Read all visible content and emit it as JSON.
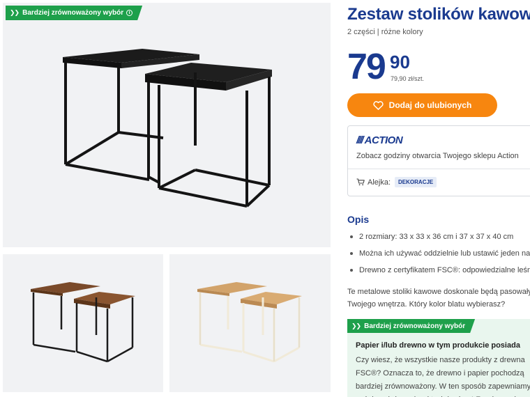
{
  "gallery": {
    "badge_label": "Bardziej zrównoważony wybór",
    "badge_info": "i"
  },
  "product": {
    "title": "Zestaw stolików kawowych",
    "subtitle": "2 części | różne kolory",
    "price_int": "79",
    "price_dec": "90",
    "price_unit": "79,90 zł/szt.",
    "favorite_label": "Dodaj do ulubionych"
  },
  "store": {
    "logo": "ACTION",
    "hours_link": "Zobacz godziny otwarcia Twojego sklepu Action",
    "aisle_label": "Alejka:",
    "aisle_value": "DEKORACJE"
  },
  "description": {
    "heading": "Opis",
    "bullets": [
      "2 rozmiary: 33 x 33 x 36 cm i 37 x 37 x 40 cm",
      "Można ich używać oddzielnie lub ustawić jeden na drugim",
      "Drewno z certyfikatem FSC®: odpowiedzialne leśnictwo"
    ],
    "paragraph": "Te metalowe stoliki kawowe doskonale będą pasowały do Twojego wnętrza. Który kolor blatu wybierasz?"
  },
  "sustainability": {
    "badge_label": "Bardziej zrównoważony wybór",
    "title": "Papier i/lub drewno w tym produkcie posiada",
    "text": "Czy wiesz, że wszystkie nasze produkty z drewna\nFSC®? Oznacza to, że drewno i papier pochodzą\nbardziej zrównoważony. W ten sposób zapewniamy\nsośnie założonych od tych lasów. * Z wyłączeniem"
  },
  "colors": {
    "brand_blue": "#1a3a8f",
    "accent_orange": "#f7860f",
    "sustain_green": "#1ea04b",
    "panel_green": "#e9f6ee"
  },
  "icons": {
    "heart": "heart-icon",
    "cart": "cart-icon",
    "info": "info-icon",
    "chevrons": "double-chevron-icon"
  }
}
